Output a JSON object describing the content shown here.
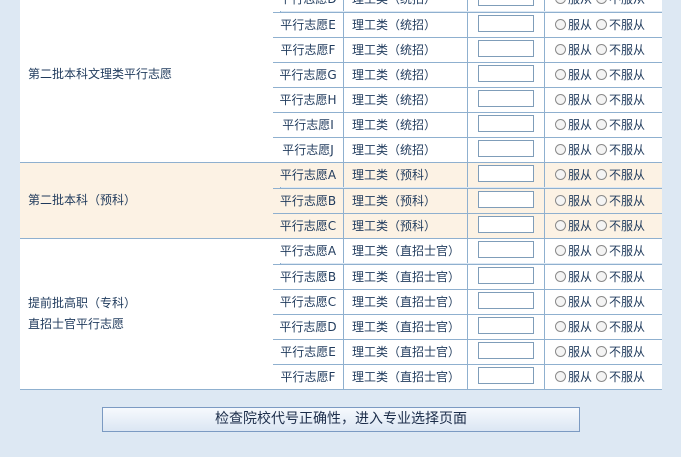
{
  "groups": [
    {
      "category": "第二批本科文理类平行志愿",
      "rows": [
        {
          "volunteer": "平行志愿D",
          "type": "理工类（统招）"
        },
        {
          "volunteer": "平行志愿E",
          "type": "理工类（统招）"
        },
        {
          "volunteer": "平行志愿F",
          "type": "理工类（统招）"
        },
        {
          "volunteer": "平行志愿G",
          "type": "理工类（统招）"
        },
        {
          "volunteer": "平行志愿H",
          "type": "理工类（统招）"
        },
        {
          "volunteer": "平行志愿I",
          "type": "理工类（统招）"
        },
        {
          "volunteer": "平行志愿J",
          "type": "理工类（统招）"
        }
      ]
    },
    {
      "category": "第二批本科（预科）",
      "rows": [
        {
          "volunteer": "平行志愿A",
          "type": "理工类（预科）"
        },
        {
          "volunteer": "平行志愿B",
          "type": "理工类（预科）"
        },
        {
          "volunteer": "平行志愿C",
          "type": "理工类（预科）"
        }
      ]
    },
    {
      "category": "提前批高职（专科）\n直招士官平行志愿",
      "rows": [
        {
          "volunteer": "平行志愿A",
          "type": "理工类（直招士官）"
        },
        {
          "volunteer": "平行志愿B",
          "type": "理工类（直招士官）"
        },
        {
          "volunteer": "平行志愿C",
          "type": "理工类（直招士官）"
        },
        {
          "volunteer": "平行志愿D",
          "type": "理工类（直招士官）"
        },
        {
          "volunteer": "平行志愿E",
          "type": "理工类（直招士官）"
        },
        {
          "volunteer": "平行志愿F",
          "type": "理工类（直招士官）"
        }
      ]
    }
  ],
  "labels": {
    "obey": "服从",
    "not_obey": "不服从"
  },
  "check_button": "检查院校代号正确性，进入专业选择页面",
  "colors": {
    "page_bg": "#dde8f3",
    "border": "#8fb0cf",
    "highlight_row": "#fcf2e4",
    "text": "#1f3a5c"
  }
}
